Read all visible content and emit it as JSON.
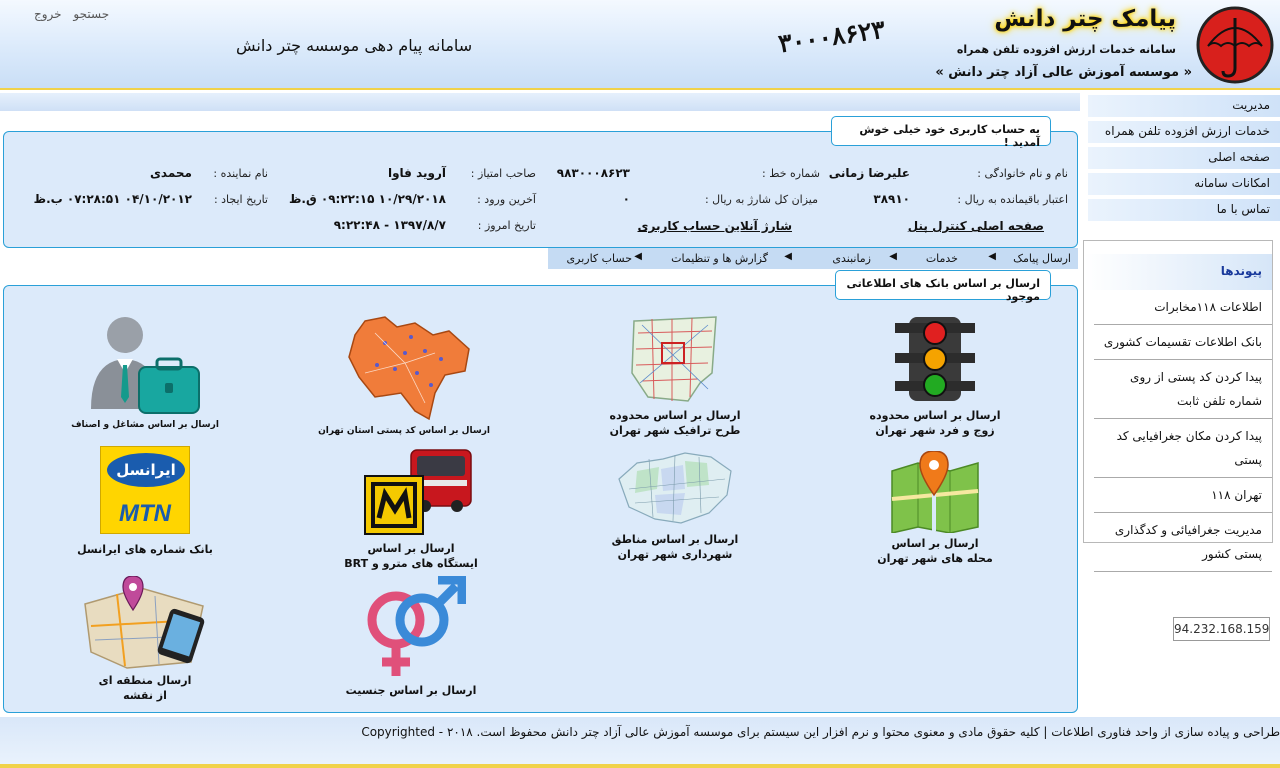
{
  "header": {
    "top_links": [
      "جستجو",
      "خروج"
    ],
    "system_title": "سامانه پیام دهی موسسه چتر دانش",
    "phone_number": "۳۰۰۰۸۶۲۳",
    "brand_title": "پیامک چتر دانش",
    "brand_subtitle": "سامانه خدمات ارزش افزوده تلفن همراه",
    "institute": "« موسسه آموزش عالی آزاد چتر دانش »"
  },
  "sidebar": {
    "menu": [
      "مدیریت",
      "خدمات ارزش افزوده تلفن همراه",
      "صفحه اصلی",
      "امکانات سامانه",
      "تماس با ما"
    ],
    "links_title": "پیوندها",
    "links": [
      "اطلاعات ۱۱۸مخابرات",
      "بانک اطلاعات تقسیمات کشوری",
      "پیدا کردن کد پستی از روی شماره تلفن ثابت",
      "پیدا کردن مکان جغرافیایی کد پستی",
      "تهران ۱۱۸",
      "مدیریت جغرافیائی و کدگذاری پستی کشور"
    ],
    "ip": "94.232.168.159"
  },
  "account": {
    "welcome": "به حساب کاربری خود خیلی خوش آمدید !",
    "name_label": "نام و نام خانوادگی :",
    "name_value": "علیرضا زمانی",
    "line_label": "شماره خط :",
    "line_value": "۹۸۳۰۰۰۸۶۲۳",
    "owner_label": "صاحب امتیاز :",
    "owner_value": "آروید فاوا",
    "rep_label": "نام نماینده :",
    "rep_value": "محمدی",
    "credit_label": "اعتبار باقیمانده به ریال :",
    "credit_value": "۳۸۹۱۰",
    "charge_label": "میزان کل شارژ به ریال :",
    "charge_value": "۰",
    "last_login_label": "آخرین ورود :",
    "last_login_value": "۱۰/۲۹/۲۰۱۸ ۰۹:۲۲:۱۵ ق.ظ",
    "created_label": "تاریخ ایجاد :",
    "created_value": "۰۴/۱۰/۲۰۱۲ ۰۷:۲۸:۵۱ ب.ظ",
    "control_link": "صفحه اصلی کنترل پنل",
    "charge_link": "شارژ آنلاین حساب کاربری",
    "today_label": "تاریخ امروز :",
    "today_value": "۱۳۹۷/۸/۷ - ۹:۲۲:۴۸"
  },
  "nav": {
    "items": [
      "ارسال پیامک",
      "خدمات",
      "زمانبندی",
      "گزارش ها و تنظیمات",
      "حساب کاربری"
    ]
  },
  "send": {
    "title": "ارسال بر اساس بانک های اطلاعاتی موجود",
    "tiles": {
      "traffic_odd_even": [
        "ارسال بر اساس محدوده",
        "زوج و فرد شهر تهران"
      ],
      "traffic_plan": [
        "ارسال بر اساس محدوده",
        "طرح ترافیک شهر تهران"
      ],
      "postal_code": "ارسال بر اساس کد پستی استان تهران",
      "jobs": "ارسال بر اساس مشاغل و اصناف",
      "neighborhood": [
        "ارسال بر اساس",
        "محله های شهر تهران"
      ],
      "municipality": [
        "ارسال بر اساس مناطق",
        "شهرداری شهر تهران"
      ],
      "metro": [
        "ارسال بر اساس",
        "ایستگاه های مترو و BRT"
      ],
      "irancell": "بانک شماره های ایرانسل",
      "gender": "ارسال بر اساس جنسیت",
      "map_area": [
        "ارسال منطقه ای",
        "از نقشه"
      ],
      "irancell_logo": "ایرانسل",
      "mtn_logo": "MTN"
    }
  },
  "footer": {
    "text": "طراحی و پیاده سازی از واحد فناوری اطلاعات | کلیه حقوق مادی و معنوی محتوا و نرم افزار این سیستم برای موسسه آموزش عالی آزاد چتر دانش محفوظ است. ۲۰۱۸ - Copyrighted"
  },
  "colors": {
    "accent": "#2aa0d8",
    "panel": "#dceafa",
    "gold": "#f0d24a",
    "logo_red": "#d8201c"
  }
}
